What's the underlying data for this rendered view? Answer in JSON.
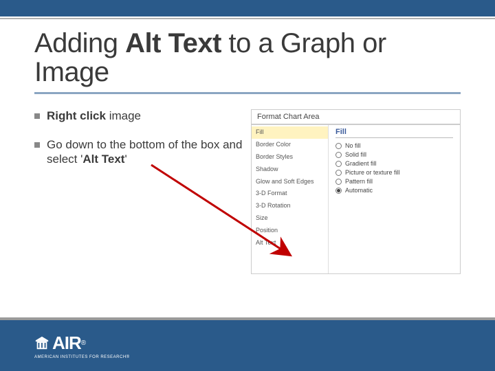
{
  "title": {
    "pre": "Adding ",
    "bold": "Alt Text",
    "post": " to a Graph or Image"
  },
  "bullets": [
    {
      "parts": [
        {
          "t": "Right click",
          "b": true
        },
        {
          "t": " image",
          "b": false
        }
      ]
    },
    {
      "parts": [
        {
          "t": "Go down to the bottom of the box and select '",
          "b": false
        },
        {
          "t": "Alt Text",
          "b": true
        },
        {
          "t": "'",
          "b": false
        }
      ]
    }
  ],
  "dialog": {
    "title": "Format Chart Area",
    "sidebar": [
      {
        "label": "Fill",
        "selected": true
      },
      {
        "label": "Border Color"
      },
      {
        "label": "Border Styles"
      },
      {
        "label": "Shadow"
      },
      {
        "label": "Glow and Soft Edges"
      },
      {
        "label": "3-D Format"
      },
      {
        "label": "3-D Rotation"
      },
      {
        "label": "Size"
      },
      {
        "label": "Position"
      },
      {
        "label": "Alt Text"
      }
    ],
    "panel_heading": "Fill",
    "radios": [
      {
        "label": "No fill",
        "checked": false
      },
      {
        "label": "Solid fill",
        "checked": false
      },
      {
        "label": "Gradient fill",
        "checked": false
      },
      {
        "label": "Picture or texture fill",
        "checked": false
      },
      {
        "label": "Pattern fill",
        "checked": false
      },
      {
        "label": "Automatic",
        "checked": true
      }
    ]
  },
  "footer": {
    "brand": "AIR",
    "reg": "®",
    "sub": "AMERICAN INSTITUTES FOR RESEARCH®"
  }
}
